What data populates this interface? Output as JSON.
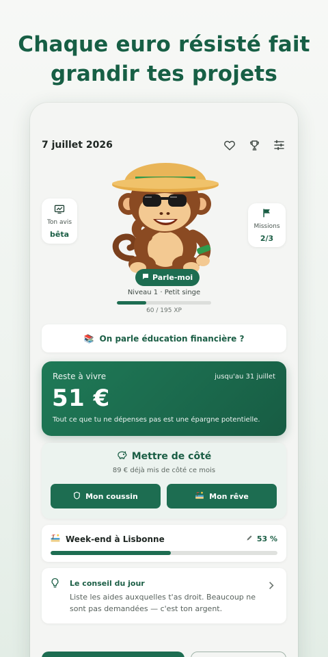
{
  "headline": {
    "line1": "Chaque euro résisté fait",
    "line2": "grandir tes projets"
  },
  "header": {
    "date": "7 juillet 2026",
    "icons": [
      "heart-icon",
      "trophy-icon",
      "sliders-icon"
    ]
  },
  "feedback_card": {
    "label": "Ton avis",
    "value": "bêta",
    "icon": "chart-feedback-icon"
  },
  "missions_card": {
    "label": "Missions",
    "value": "2/3",
    "icon": "flag-icon"
  },
  "mascot": {
    "name": "monkey-mascot",
    "talk_label": "Parle-moi"
  },
  "level": {
    "text": "Niveau 1 · Petit singe",
    "xp_text": "60 / 195 XP",
    "xp_fraction": 0.31
  },
  "education": {
    "emoji": "📚",
    "label": "On parle éducation financière ?"
  },
  "reste_a_vivre": {
    "label": "Reste à vivre",
    "until": "jusqu'au 31 juillet",
    "amount": "51 €",
    "note": "Tout ce que tu ne dépenses pas est une épargne potentielle."
  },
  "savings": {
    "title": "Mettre de côté",
    "subtitle": "89 € déjà mis de côté ce mois",
    "buttons": [
      {
        "label": "Mon coussin",
        "icon": "shield-icon"
      },
      {
        "label": "Mon rêve",
        "icon": "beach-icon"
      }
    ]
  },
  "goal": {
    "emoji": "🏖️",
    "name": "Week-end à Lisbonne",
    "percent_text": "53 %",
    "progress": 0.53
  },
  "tip": {
    "title": "Le conseil du jour",
    "body": "Liste les aides auxquelles t'as droit. Beaucoup ne sont pas demandées — c'est ton argent."
  },
  "colors": {
    "brand": "#1d6d51",
    "brand_dark": "#175f45",
    "background": "#f4f5f3"
  }
}
